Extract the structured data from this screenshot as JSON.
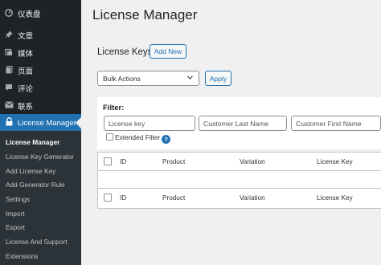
{
  "sidebar": {
    "items": [
      {
        "label": "仪表盘",
        "icon": "dashboard-icon"
      },
      {
        "label": "文章",
        "icon": "pin-icon"
      },
      {
        "label": "媒体",
        "icon": "media-icon"
      },
      {
        "label": "页面",
        "icon": "page-icon"
      },
      {
        "label": "评论",
        "icon": "comment-icon"
      },
      {
        "label": "联系",
        "icon": "mail-icon"
      },
      {
        "label": "License Manager",
        "icon": "lock-icon",
        "current": true
      }
    ],
    "submenu": [
      {
        "label": "License Manager",
        "active": true
      },
      {
        "label": "License Key Generator"
      },
      {
        "label": "Add License Key"
      },
      {
        "label": "Add Generator Rule"
      },
      {
        "label": "Settings"
      },
      {
        "label": "Import"
      },
      {
        "label": "Export"
      },
      {
        "label": "License And Support"
      },
      {
        "label": "Extensions"
      }
    ]
  },
  "main": {
    "title": "License Manager",
    "section_heading": "License Keys",
    "add_new_label": "Add New",
    "bulk_actions": {
      "selected": "Bulk Actions",
      "apply_label": "Apply"
    },
    "filter": {
      "label": "Filter:",
      "license_key_placeholder": "License key",
      "last_name_placeholder": "Customer Last Name",
      "first_name_placeholder": "Customer First Name",
      "extended_filter_label": "Extended Filter",
      "help_glyph": "?"
    },
    "table": {
      "columns": [
        "ID",
        "Product",
        "Variation",
        "License Key"
      ]
    }
  },
  "colors": {
    "sidebar_bg": "#1d2327",
    "accent": "#2271b1",
    "page_bg": "#f0f0f1"
  }
}
